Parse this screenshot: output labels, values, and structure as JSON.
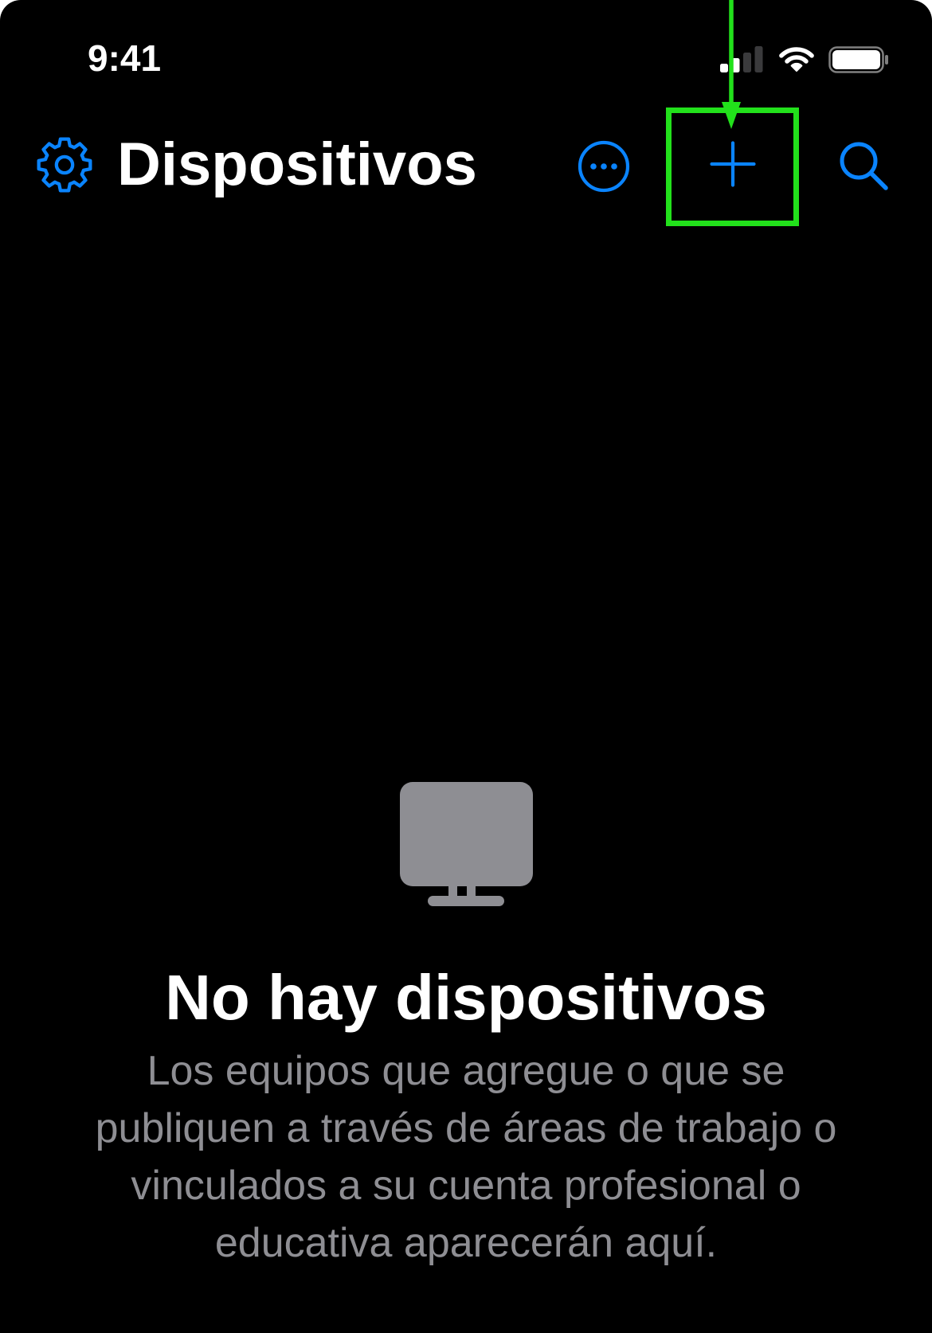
{
  "status_bar": {
    "time": "9:41",
    "icons": {
      "signal": "cellular-signal-icon",
      "wifi": "wifi-icon",
      "battery": "battery-icon"
    },
    "signal_bars_active": 2,
    "signal_bars_total": 4,
    "battery_level": 1.0
  },
  "nav_bar": {
    "title": "Dispositivos",
    "icons": {
      "settings": "gear-icon",
      "more": "ellipsis-circle-icon",
      "add": "plus-icon",
      "search": "magnifying-glass-icon"
    }
  },
  "empty_state": {
    "icon": "desktop-monitor-icon",
    "title": "No hay dispositivos",
    "message": "Los equipos que agregue o que se publiquen a través de áreas de trabajo o vinculados a su cuenta profesional o educativa aparecerán aquí."
  },
  "colors": {
    "accent": "#0A84FF",
    "background": "#000000",
    "primary_text": "#FFFFFF",
    "secondary_text": "#8E8E93",
    "empty_icon": "#8E8E93",
    "annotation": "#22E11B"
  }
}
